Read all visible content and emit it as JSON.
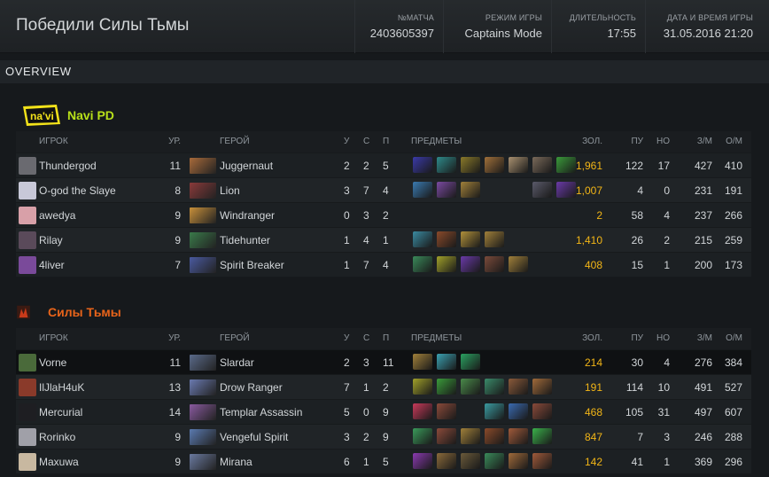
{
  "header": {
    "title": "Победили Силы Тьмы",
    "match_id_label": "№МАТЧА",
    "match_id": "2403605397",
    "mode_label": "РЕЖИМ ИГРЫ",
    "mode": "Captains Mode",
    "duration_label": "ДЛИТЕЛЬНОСТЬ",
    "duration": "17:55",
    "date_label": "ДАТА И ВРЕМЯ ИГРЫ",
    "date": "31.05.2016 21:20"
  },
  "overview": {
    "label": "OVERVIEW"
  },
  "columns": {
    "player": "ИГРОК",
    "level": "УР.",
    "hero": "ГЕРОЙ",
    "kills": "У",
    "deaths": "С",
    "assists": "П",
    "items": "ПРЕДМЕТЫ",
    "gold": "ЗОЛ.",
    "last_hits": "ПУ",
    "denies": "НО",
    "gpm": "З/М",
    "xpm": "О/М"
  },
  "teams": [
    {
      "name": "Navi PD",
      "color": "#b8e01a",
      "players": [
        {
          "name": "Thundergod",
          "level": "11",
          "hero": "Juggernaut",
          "k": "2",
          "d": "2",
          "a": "5",
          "gold": "1,961",
          "lh": "122",
          "dn": "17",
          "gpm": "427",
          "xpm": "410",
          "avatar": "#6a6a70",
          "portrait": "#a86a3a",
          "items": [
            "#3a3aa8",
            "#2e8a8a",
            "#8a7a2a",
            "#a0703a",
            "#a89070",
            "#7a6a5a",
            "#3a9a3a"
          ]
        },
        {
          "name": "O-god the Slaye",
          "level": "8",
          "hero": "Lion",
          "k": "3",
          "d": "7",
          "a": "4",
          "gold": "1,007",
          "lh": "4",
          "dn": "0",
          "gpm": "231",
          "xpm": "191",
          "avatar": "#c8c8d8",
          "portrait": "#8a3a3a",
          "items": [
            "#3a7ab0",
            "#7a4aa0",
            "#a0803a",
            "",
            "",
            "#5a5a6a",
            "#6a3aa8"
          ]
        },
        {
          "name": "awedya",
          "level": "9",
          "hero": "Windranger",
          "k": "0",
          "d": "3",
          "a": "2",
          "gold": "2",
          "lh": "58",
          "dn": "4",
          "gpm": "237",
          "xpm": "266",
          "avatar": "#d8a0a8",
          "portrait": "#c8903a",
          "items": []
        },
        {
          "name": "Rilay",
          "level": "9",
          "hero": "Tidehunter",
          "k": "1",
          "d": "4",
          "a": "1",
          "gold": "1,410",
          "lh": "26",
          "dn": "2",
          "gpm": "215",
          "xpm": "259",
          "avatar": "#5a4a5a",
          "portrait": "#3a7a4a",
          "items": [
            "#3a8aa0",
            "#8a4a2a",
            "#b0903a",
            "#a0803a",
            "",
            "",
            ""
          ]
        },
        {
          "name": "4liver",
          "level": "7",
          "hero": "Spirit Breaker",
          "k": "1",
          "d": "7",
          "a": "4",
          "gold": "408",
          "lh": "15",
          "dn": "1",
          "gpm": "200",
          "xpm": "173",
          "avatar": "#7a4a9a",
          "portrait": "#4a5aa0",
          "items": [
            "#3a8a5a",
            "#a0a02a",
            "#6a3aa8",
            "#7a4a3a",
            "#a0803a",
            "",
            ""
          ]
        }
      ]
    },
    {
      "name": "Силы Тьмы",
      "color": "#e8641a",
      "players": [
        {
          "name": "Vorne",
          "level": "11",
          "hero": "Slardar",
          "k": "2",
          "d": "3",
          "a": "11",
          "gold": "214",
          "lh": "30",
          "dn": "4",
          "gpm": "276",
          "xpm": "384",
          "avatar": "#4a6a3a",
          "portrait": "#5a6a8a",
          "items": [
            "#a0803a",
            "#3aa0b0",
            "#2aa060",
            "",
            "",
            "",
            ""
          ]
        },
        {
          "name": "IlJlaH4uK",
          "level": "13",
          "hero": "Drow Ranger",
          "k": "7",
          "d": "1",
          "a": "2",
          "gold": "191",
          "lh": "114",
          "dn": "10",
          "gpm": "491",
          "xpm": "527",
          "avatar": "#8a3a2a",
          "portrait": "#6a7ab0",
          "items": [
            "#a0a02a",
            "#3a9a3a",
            "#4a8a4a",
            "#3a8a6a",
            "#8a5a3a",
            "#a06a3a",
            ""
          ]
        },
        {
          "name": "Mercurial",
          "level": "14",
          "hero": "Templar Assassin",
          "k": "5",
          "d": "0",
          "a": "9",
          "gold": "468",
          "lh": "105",
          "dn": "31",
          "gpm": "497",
          "xpm": "607",
          "avatar": "#1e1e22",
          "portrait": "#8a5aa0",
          "items": [
            "#c83a5a",
            "#8a4a3a",
            "",
            "#3a9aa0",
            "#3a6ab0",
            "#8a4a3a",
            ""
          ]
        },
        {
          "name": "Rorinko",
          "level": "9",
          "hero": "Vengeful Spirit",
          "k": "3",
          "d": "2",
          "a": "9",
          "gold": "847",
          "lh": "7",
          "dn": "3",
          "gpm": "246",
          "xpm": "288",
          "avatar": "#a0a0a8",
          "portrait": "#5a7ab0",
          "items": [
            "#3a9a5a",
            "#8a4a3a",
            "#a0803a",
            "#8a4a2a",
            "#a05a3a",
            "#3ab04a",
            ""
          ]
        },
        {
          "name": "Maxuwa",
          "level": "9",
          "hero": "Mirana",
          "k": "6",
          "d": "1",
          "a": "5",
          "gold": "142",
          "lh": "41",
          "dn": "1",
          "gpm": "369",
          "xpm": "296",
          "avatar": "#c8b8a0",
          "portrait": "#6a7aa0",
          "items": [
            "#8a3ab0",
            "#8a6a3a",
            "#6a5a3a",
            "#3a8a5a",
            "#a06a3a",
            "#a05a3a",
            ""
          ]
        }
      ]
    }
  ]
}
